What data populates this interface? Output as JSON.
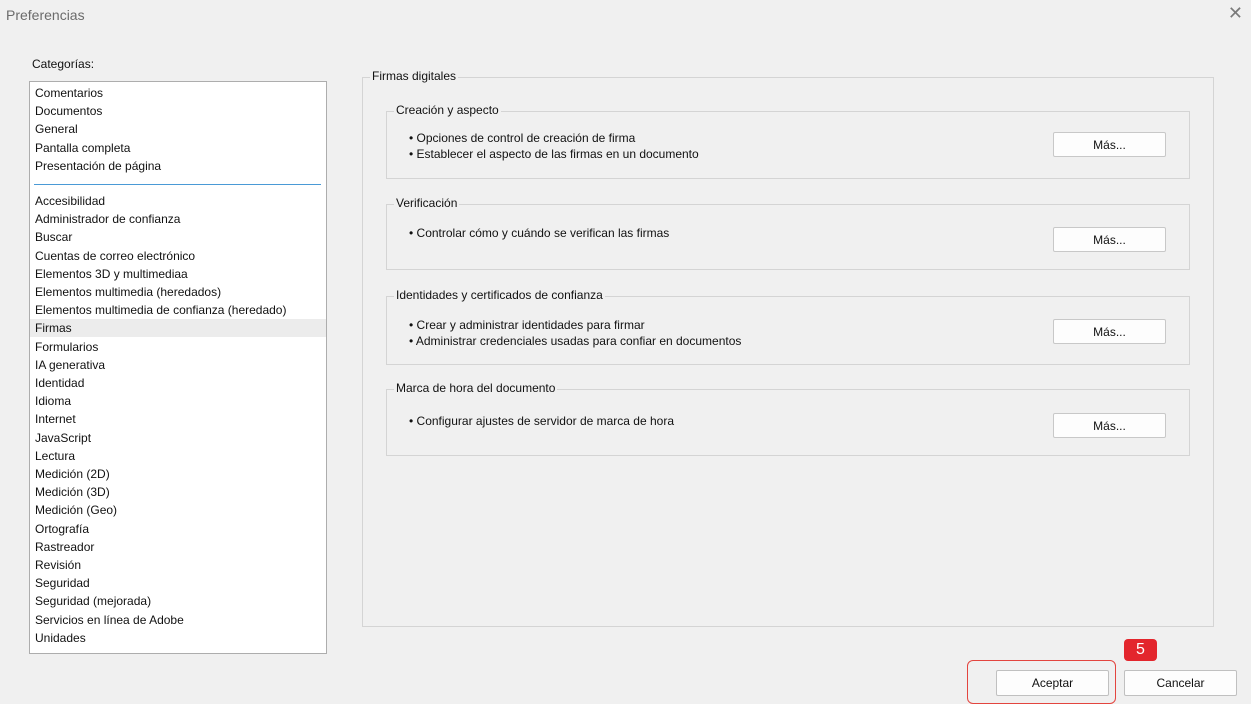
{
  "window": {
    "title": "Preferencias",
    "close_glyph": "✕"
  },
  "categories": {
    "label": "Categorías:",
    "group1": [
      "Comentarios",
      "Documentos",
      "General",
      "Pantalla completa",
      "Presentación de página"
    ],
    "group2": [
      "Accesibilidad",
      "Administrador de confianza",
      "Buscar",
      "Cuentas de correo electrónico",
      "Elementos 3D y multimediaa",
      "Elementos multimedia (heredados)",
      "Elementos multimedia de confianza (heredado)",
      "Firmas",
      "Formularios",
      "IA generativa",
      "Identidad",
      "Idioma",
      "Internet",
      "JavaScript",
      "Lectura",
      "Medición (2D)",
      "Medición (3D)",
      "Medición (Geo)",
      "Ortografía",
      "Rastreador",
      "Revisión",
      "Seguridad",
      "Seguridad (mejorada)",
      "Servicios en línea de Adobe",
      "Unidades"
    ],
    "selected": "Firmas"
  },
  "panel": {
    "title": "Firmas digitales",
    "sections": [
      {
        "title": "Creación y aspecto",
        "bullets": [
          "• Opciones de control de creación de firma",
          "• Establecer el aspecto de las firmas en un documento"
        ],
        "button": "Más..."
      },
      {
        "title": "Verificación",
        "bullets": [
          "• Controlar cómo y cuándo se verifican las firmas"
        ],
        "button": "Más..."
      },
      {
        "title": "Identidades y certificados de confianza",
        "bullets": [
          "• Crear y administrar identidades para firmar",
          "• Administrar credenciales usadas para confiar en documentos"
        ],
        "button": "Más..."
      },
      {
        "title": "Marca de hora del documento",
        "bullets": [
          "• Configurar ajustes de servidor de marca de hora"
        ],
        "button": "Más..."
      }
    ]
  },
  "footer": {
    "ok_label": "Aceptar",
    "cancel_label": "Cancelar"
  },
  "annotation": {
    "step_number": "5",
    "color": "#e3262d"
  }
}
